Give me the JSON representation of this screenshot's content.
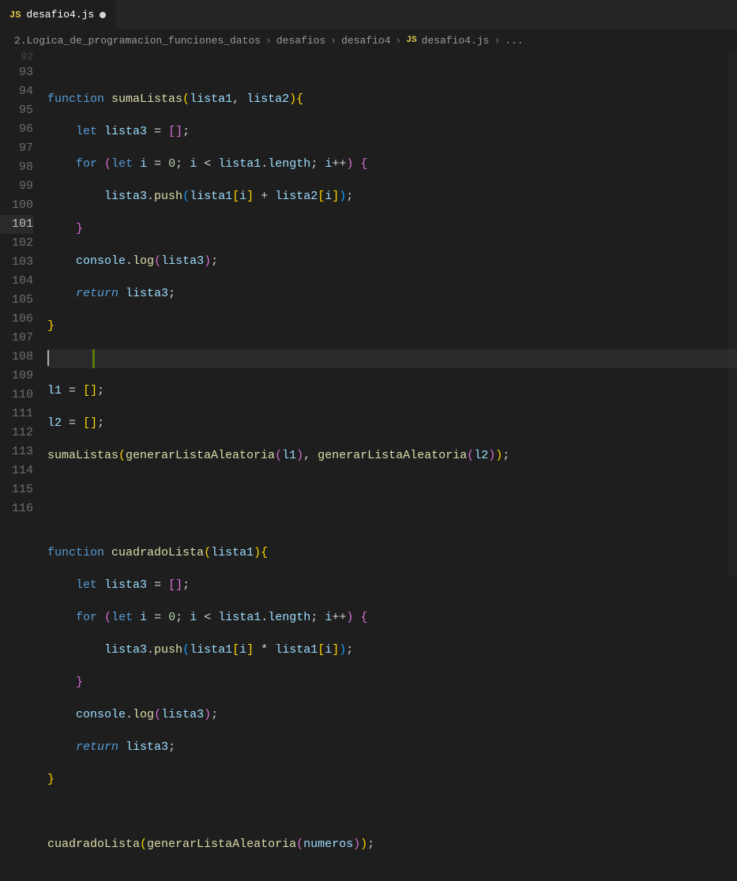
{
  "tab": {
    "icon": "JS",
    "filename": "desafio4.js",
    "dirty": true
  },
  "breadcrumbs": {
    "segments": [
      "2.Logica_de_programacion_funciones_datos",
      "desafios",
      "desafio4"
    ],
    "fileIcon": "JS",
    "file": "desafio4.js",
    "trailing": "..."
  },
  "lineNumbers": [
    "92",
    "93",
    "94",
    "95",
    "96",
    "97",
    "98",
    "99",
    "100",
    "101",
    "102",
    "103",
    "104",
    "105",
    "106",
    "107",
    "108",
    "109",
    "110",
    "111",
    "112",
    "113",
    "114",
    "115",
    "116"
  ],
  "code": {
    "l92": "",
    "l93": {
      "kw": "function",
      "fn": "sumaListas",
      "p1": "lista1",
      "p2": "lista2"
    },
    "l94": {
      "kw": "let",
      "v": "lista3"
    },
    "l95": {
      "kw": "for",
      "kw2": "let",
      "v": "i",
      "n": "0",
      "arr": "lista1",
      "prop": "length",
      "inc": "i"
    },
    "l96": {
      "arr": "lista3",
      "m": "push",
      "a": "lista1",
      "v": "i",
      "b": "lista2",
      "v2": "i"
    },
    "l97": "}",
    "l98": {
      "obj": "console",
      "m": "log",
      "arg": "lista3"
    },
    "l99": {
      "kw": "return",
      "v": "lista3"
    },
    "l100": "}",
    "l101": "",
    "l102": {
      "v": "l1"
    },
    "l103": {
      "v": "l2"
    },
    "l104": {
      "fn": "sumaListas",
      "g": "generarListaAleatoria",
      "a1": "l1",
      "a2": "l2"
    },
    "l105": "",
    "l106": "",
    "l107": {
      "kw": "function",
      "fn": "cuadradoLista",
      "p1": "lista1"
    },
    "l108": {
      "kw": "let",
      "v": "lista3"
    },
    "l109": {
      "kw": "for",
      "kw2": "let",
      "v": "i",
      "n": "0",
      "arr": "lista1",
      "prop": "length",
      "inc": "i"
    },
    "l110": {
      "arr": "lista3",
      "m": "push",
      "a": "lista1",
      "v": "i",
      "b": "lista1",
      "v2": "i"
    },
    "l111": "}",
    "l112": {
      "obj": "console",
      "m": "log",
      "arg": "lista3"
    },
    "l113": {
      "kw": "return",
      "v": "lista3"
    },
    "l114": "}",
    "l115": "",
    "l116": {
      "fn": "cuadradoLista",
      "g": "generarListaAleatoria",
      "a": "numeros"
    }
  }
}
